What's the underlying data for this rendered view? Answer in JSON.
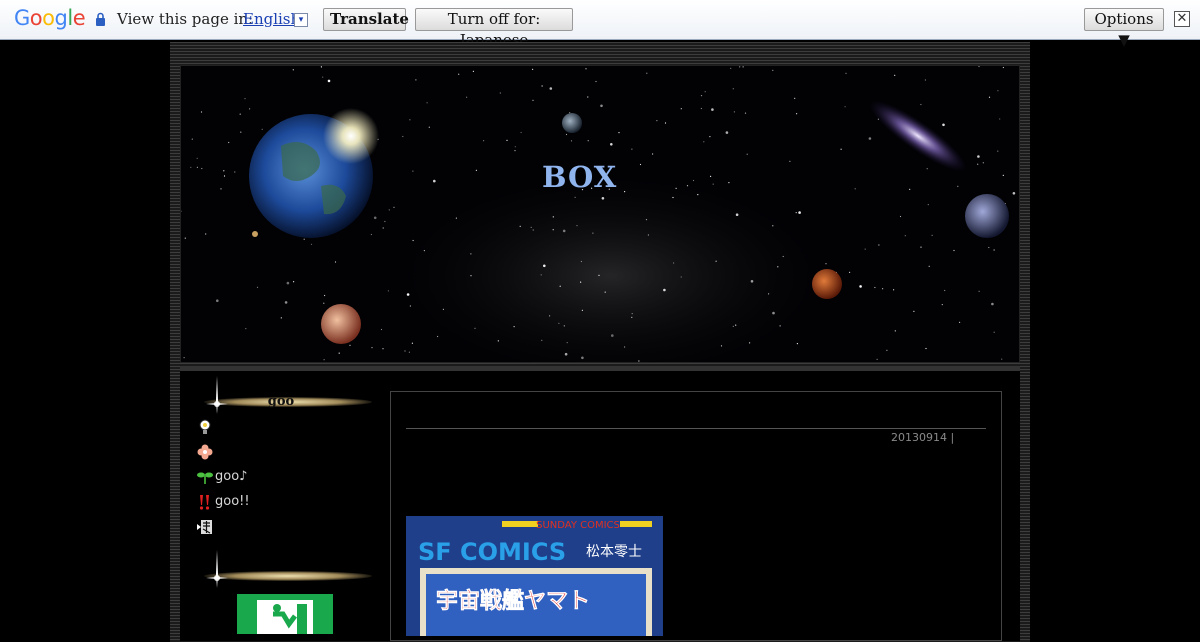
{
  "translate_bar": {
    "logo": "Google",
    "view_label": "View this page in:",
    "language": "English",
    "dropdown_glyph": "▾",
    "translate_button": "Translate",
    "turn_off_button": "Turn off for: Japanese",
    "options_button": "Options ▼",
    "close_glyph": "✕"
  },
  "header": {
    "title": "BOX"
  },
  "sidebar": {
    "section1_title": "goo",
    "section2_title": "",
    "items": [
      {
        "icon": "lightbulb-icon",
        "label": ""
      },
      {
        "icon": "flower-icon",
        "label": ""
      },
      {
        "icon": "sprout-icon",
        "label": "goo♪"
      },
      {
        "icon": "exclamation-icon",
        "label": "goo!!"
      },
      {
        "icon": "kanji-icon",
        "label": ""
      }
    ]
  },
  "article": {
    "date": "20130914 |"
  },
  "cover": {
    "publisher": "SUNDAY COMICS",
    "series": "SF COMICS",
    "author": "松本零士",
    "title": "宇宙戦艦ヤマト"
  },
  "colors": {
    "title": "#8fb4ee",
    "background": "#000000",
    "exit_green": "#1aa84c"
  }
}
